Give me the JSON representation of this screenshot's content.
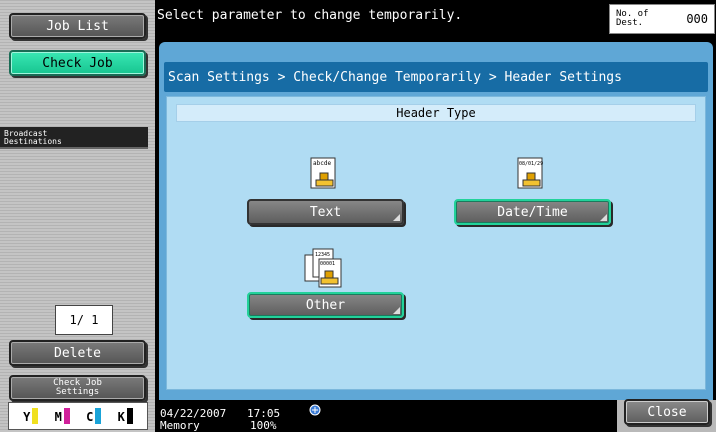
{
  "sidebar": {
    "job_list": "Job List",
    "check_job": "Check Job",
    "broadcast_line1": "Broadcast",
    "broadcast_line2": "Destinations",
    "page_count": "1/ 1",
    "delete": "Delete",
    "check_job_settings_line1": "Check Job",
    "check_job_settings_line2": "Settings",
    "toner": [
      {
        "label": "Y",
        "color": "#f0e020"
      },
      {
        "label": "M",
        "color": "#d0209a"
      },
      {
        "label": "C",
        "color": "#19a3d8"
      },
      {
        "label": "K",
        "color": "#000000"
      }
    ]
  },
  "header": {
    "message": "Select parameter to change temporarily.",
    "dest_label_line1": "No. of",
    "dest_label_line2": "Dest.",
    "dest_count": "000"
  },
  "main": {
    "breadcrumb": "Scan Settings > Check/Change Temporarily > Header Settings",
    "section_title": "Header Type",
    "options": {
      "text": {
        "label": "Text",
        "icon_text": "abcde",
        "selected": false
      },
      "datetime": {
        "label": "Date/Time",
        "icon_text": "08/01/29",
        "selected": true
      },
      "other": {
        "label": "Other",
        "icon_text_a": "12345",
        "icon_text_b": "00001",
        "selected": true
      }
    }
  },
  "status": {
    "date": "04/22/2007",
    "time": "17:05",
    "memory_label": "Memory",
    "memory_value": "100%"
  },
  "footer": {
    "close": "Close"
  }
}
